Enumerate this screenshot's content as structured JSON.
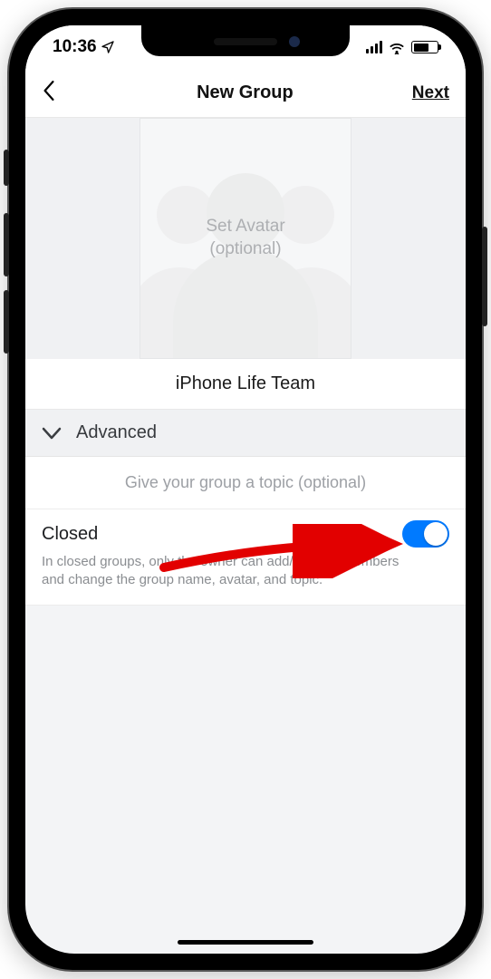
{
  "status": {
    "time": "10:36",
    "location_icon": "location-arrow"
  },
  "nav": {
    "title": "New Group",
    "next": "Next"
  },
  "avatar": {
    "line1": "Set Avatar",
    "line2": "(optional)"
  },
  "group_name": "iPhone Life Team",
  "advanced": {
    "label": "Advanced"
  },
  "topic": {
    "placeholder": "Give your group a topic (optional)"
  },
  "closed": {
    "title": "Closed",
    "description": "In closed groups, only the owner can add/remove members and change the group name, avatar, and topic.",
    "enabled": true
  },
  "colors": {
    "accent": "#007aff"
  }
}
